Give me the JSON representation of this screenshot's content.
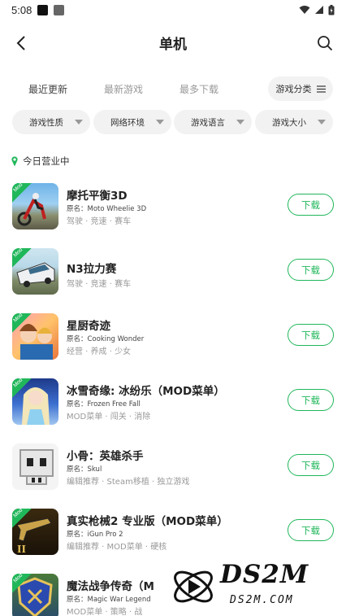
{
  "status_bar": {
    "time": "5:08"
  },
  "header": {
    "title": "单机"
  },
  "tabs": [
    {
      "label": "最近更新",
      "active": true
    },
    {
      "label": "最新游戏",
      "active": false
    },
    {
      "label": "最多下载",
      "active": false
    }
  ],
  "category_button": {
    "label": "游戏分类"
  },
  "filters": [
    {
      "label": "游戏性质"
    },
    {
      "label": "网络环境"
    },
    {
      "label": "游戏语言"
    },
    {
      "label": "游戏大小"
    }
  ],
  "section": {
    "title": "今日营业中"
  },
  "games": [
    {
      "name": "摩托平衡3D",
      "orig": "原名：Moto Wheelie 3D",
      "tags": "驾驶 · 竞速 · 赛车",
      "mod": true,
      "icon": "moto-icon",
      "button": "下载"
    },
    {
      "name": "N3拉力赛",
      "orig": "",
      "tags": "驾驶 · 竞速 · 赛车",
      "mod": true,
      "icon": "rally-icon",
      "button": "下载"
    },
    {
      "name": "星厨奇迹",
      "orig": "原名：Cooking Wonder",
      "tags": "经营 · 养成 · 少女",
      "mod": true,
      "icon": "cooking-icon",
      "button": "下载"
    },
    {
      "name": "冰雪奇缘: 冰纷乐（MOD菜单）",
      "orig": "原名：Frozen Free Fall",
      "tags": "MOD菜单 · 闯关 · 消除",
      "mod": true,
      "icon": "frozen-icon",
      "button": "下载"
    },
    {
      "name": "小骨：英雄杀手",
      "orig": "原名：Skul",
      "tags": "编辑推荐 · Steam移植 · 独立游戏",
      "mod": false,
      "icon": "skul-icon",
      "button": "下载"
    },
    {
      "name": "真实枪械2 专业版（MOD菜单）",
      "orig": "原名：iGun Pro 2",
      "tags": "编辑推荐 · MOD菜单 · 硬核",
      "mod": true,
      "icon": "gun-icon",
      "button": "下载"
    },
    {
      "name": "魔法战争传奇（M",
      "orig": "原名：Magic War Legend",
      "tags": "MOD菜单 · 策略 · 战",
      "mod": true,
      "icon": "magic-war-icon",
      "button": ""
    }
  ],
  "watermark": {
    "text": "DS2M",
    "sub": "DS2M.COM"
  },
  "colors": {
    "accent": "#20b75a",
    "pill_bg": "#f2f2f2"
  }
}
